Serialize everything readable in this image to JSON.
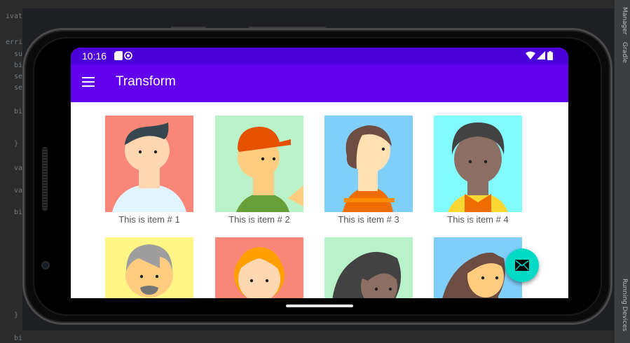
{
  "ide": {
    "code_fragments": [
      "ivat",
      "erri",
      "su",
      "bi",
      "se",
      "se",
      "bi",
      "}",
      "va",
      "va",
      "bi",
      "}",
      "bi"
    ],
    "right_tabs": [
      "Manager",
      "Gradle",
      "Running Devices"
    ]
  },
  "status_bar": {
    "time": "10:16",
    "icons": [
      "sd-card-icon",
      "sync-icon",
      "wifi-icon",
      "signal-icon",
      "battery-icon"
    ]
  },
  "app_bar": {
    "title": "Transform",
    "menu_icon": "hamburger-menu-icon",
    "color": "#6200ee",
    "status_color": "#4c00d9"
  },
  "items": [
    {
      "label": "This is item # 1",
      "bg": "#f8877a"
    },
    {
      "label": "This is item # 2",
      "bg": "#b9f2c9"
    },
    {
      "label": "This is item # 3",
      "bg": "#80cefa"
    },
    {
      "label": "This is item # 4",
      "bg": "#82fbff"
    },
    {
      "label": "",
      "bg": "#fff685"
    },
    {
      "label": "",
      "bg": "#f8877a"
    },
    {
      "label": "",
      "bg": "#b9f2c9"
    },
    {
      "label": "",
      "bg": "#80cefa"
    }
  ],
  "fab": {
    "icon": "email-icon",
    "color": "#03dac5"
  }
}
